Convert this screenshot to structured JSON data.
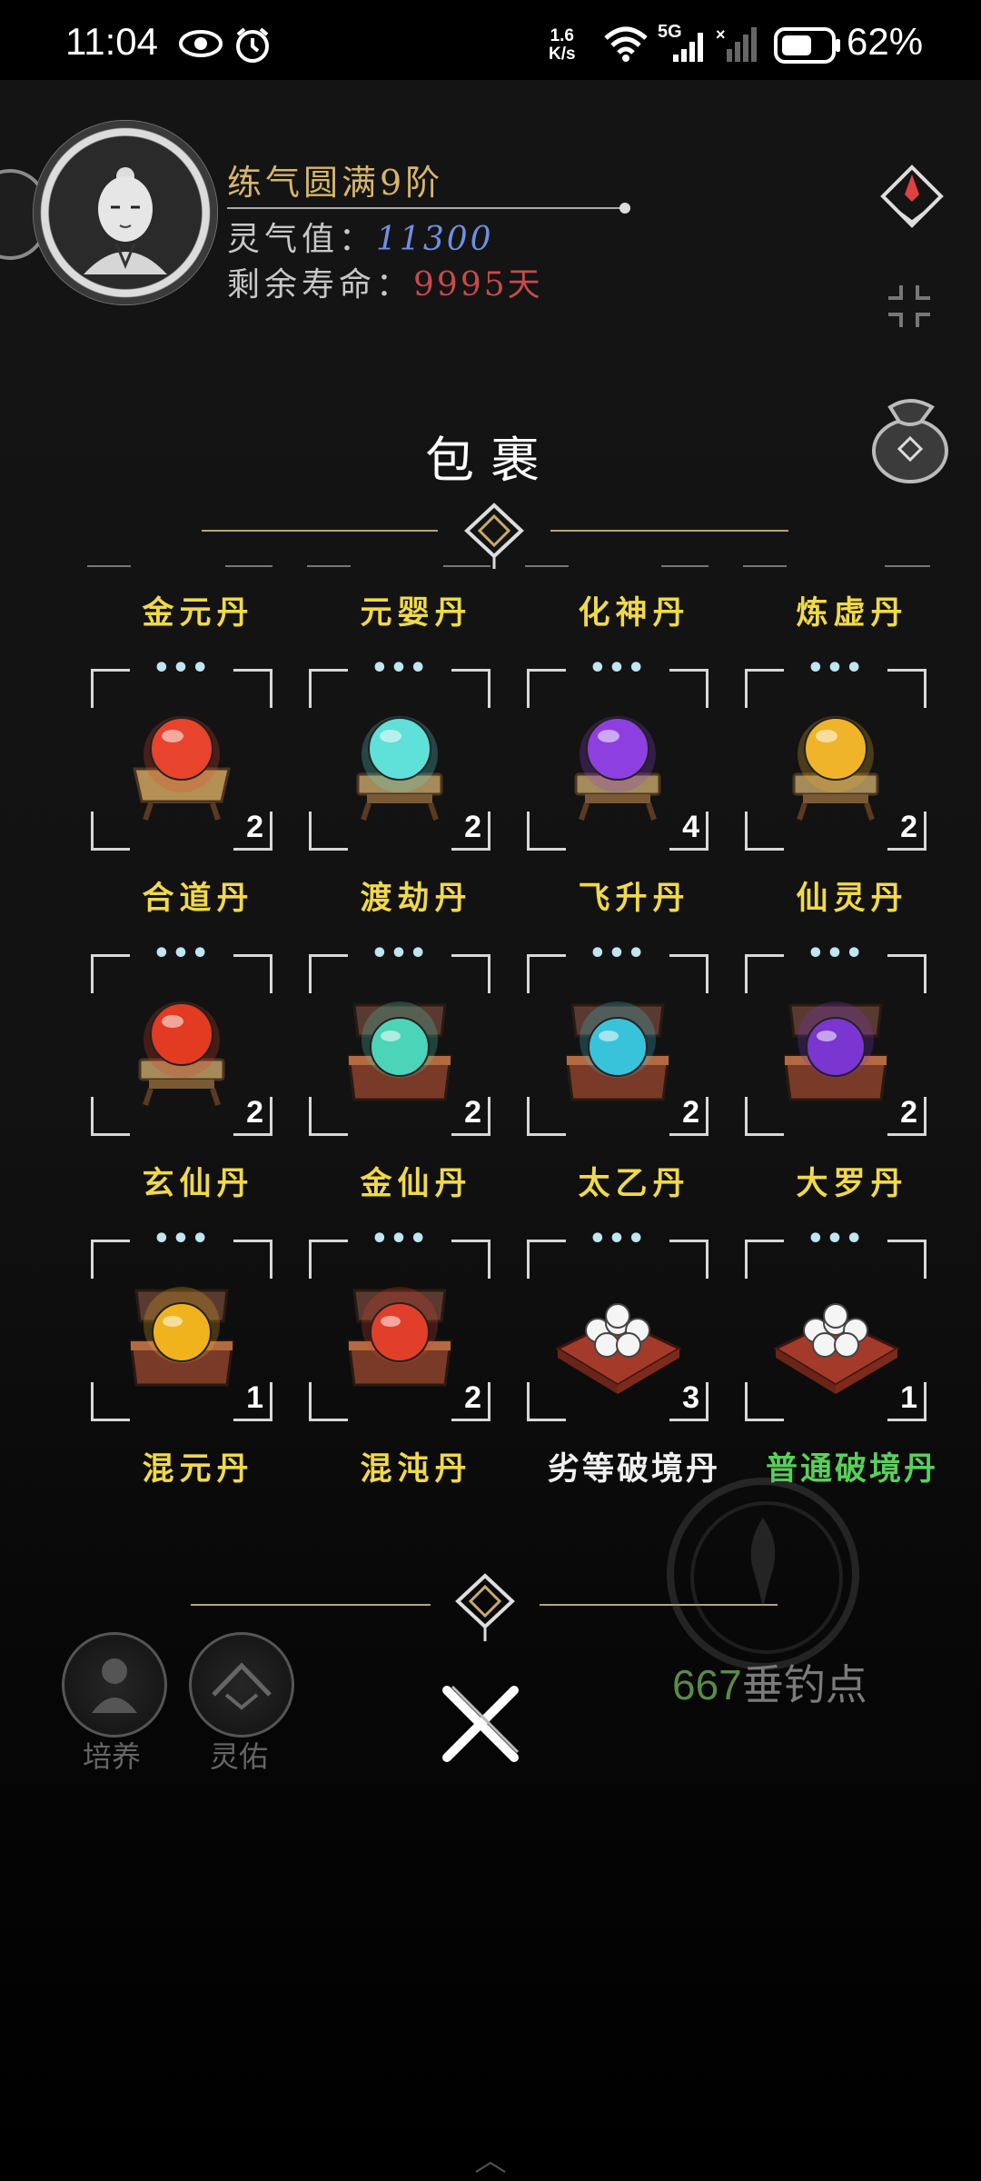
{
  "status_bar": {
    "time": "11:04",
    "speed_value": "1.6",
    "speed_unit": "K/s",
    "network": "5G",
    "battery": "62%"
  },
  "profile": {
    "realm": "练气圆满9阶",
    "qi_label": "灵气值：",
    "qi_value": "11300",
    "life_label": "剩余寿命：",
    "life_value": "9995天"
  },
  "bag": {
    "title": "包裹",
    "items": [
      {
        "name": "金元丹",
        "count": "2",
        "orb": "#e8432c",
        "box": "crate"
      },
      {
        "name": "元婴丹",
        "count": "2",
        "orb": "#5fe0d8",
        "box": "stand"
      },
      {
        "name": "化神丹",
        "count": "4",
        "orb": "#8e3fe0",
        "box": "stand"
      },
      {
        "name": "炼虚丹",
        "count": "2",
        "orb": "#f0b42a",
        "box": "stand"
      },
      {
        "name": "合道丹",
        "count": "2",
        "orb": "#e33a22",
        "box": "stand"
      },
      {
        "name": "渡劫丹",
        "count": "2",
        "orb": "#4cd4b8",
        "box": "chest"
      },
      {
        "name": "飞升丹",
        "count": "2",
        "orb": "#39c3db",
        "box": "chest"
      },
      {
        "name": "仙灵丹",
        "count": "2",
        "orb": "#7b35d0",
        "box": "chest"
      },
      {
        "name": "玄仙丹",
        "count": "1",
        "orb": "#f0b31e",
        "box": "chest"
      },
      {
        "name": "金仙丹",
        "count": "2",
        "orb": "#e23f2a",
        "box": "chest"
      },
      {
        "name": "太乙丹",
        "count": "3",
        "orb": "#ffffff",
        "box": "pillow"
      },
      {
        "name": "大罗丹",
        "count": "1",
        "orb": "#ffffff",
        "box": "pillow"
      }
    ],
    "bottom_labels": [
      {
        "name": "混元丹",
        "color": "#f0d94a"
      },
      {
        "name": "混沌丹",
        "color": "#f0d94a"
      },
      {
        "name": "劣等破境丹",
        "color": "#f0f0f0"
      },
      {
        "name": "普通破境丹",
        "color": "#58d05a"
      }
    ]
  },
  "fishing": {
    "points_value": "667",
    "points_label": "垂钓点"
  },
  "side_buttons": [
    {
      "label": "培养",
      "icon": "cultivator-icon"
    },
    {
      "label": "灵佑",
      "icon": "mountain-icon"
    }
  ],
  "icons": {
    "right": [
      "compass-icon",
      "collapse-icon",
      "pouch-icon"
    ],
    "close": "close-icon"
  }
}
